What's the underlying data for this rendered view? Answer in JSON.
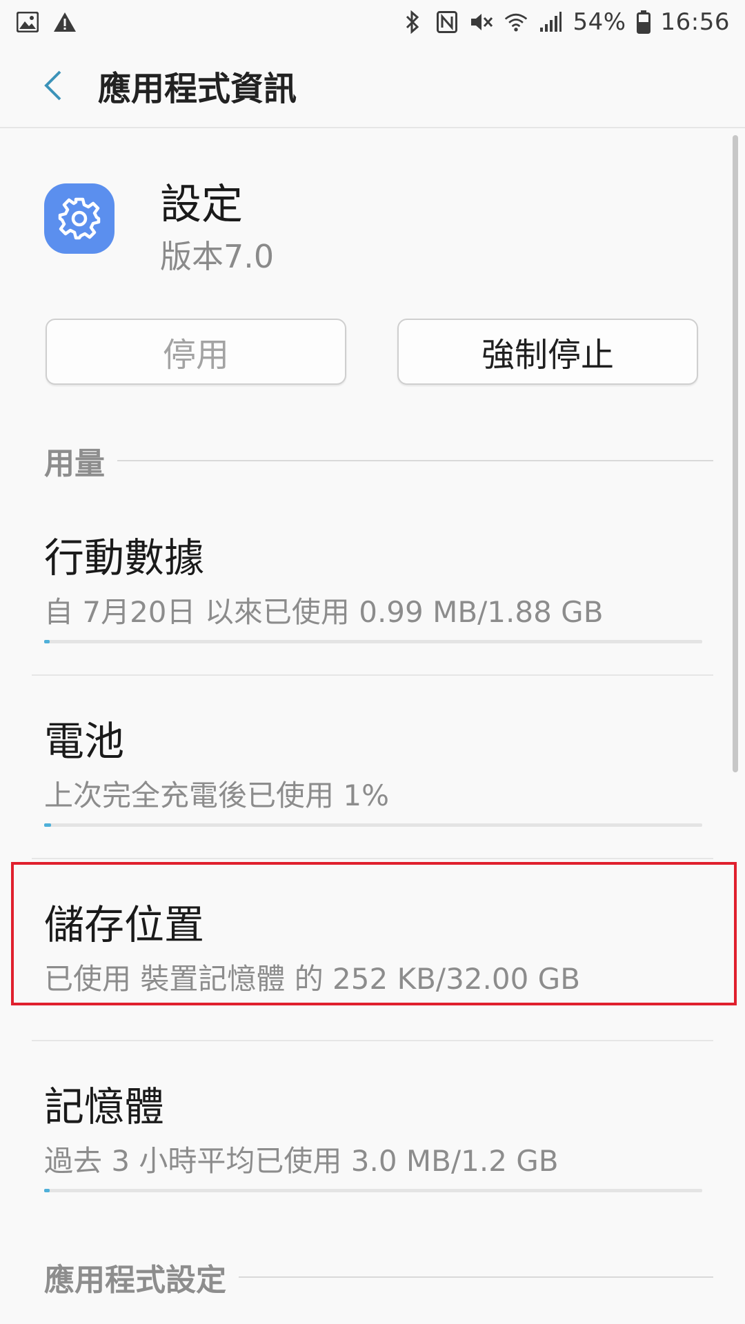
{
  "status_bar": {
    "battery_percent": "54%",
    "time": "16:56",
    "left_icons": [
      "image-icon",
      "warning-icon"
    ],
    "right_icons": [
      "bluetooth-icon",
      "nfc-icon",
      "mute-icon",
      "wifi-icon",
      "signal-icon",
      "battery-icon"
    ]
  },
  "app_bar": {
    "title": "應用程式資訊"
  },
  "app": {
    "name": "設定",
    "version": "版本7.0",
    "icon": "gear-icon",
    "icon_color": "#5b8fee"
  },
  "buttons": {
    "disable": "停用",
    "force_stop": "強制停止"
  },
  "sections": {
    "usage": "用量",
    "app_settings": "應用程式設定"
  },
  "items": [
    {
      "title": "行動數據",
      "subtitle": "自 7月20日 以來已使用 0.99 MB/1.88 GB",
      "progress": 0.0005
    },
    {
      "title": "電池",
      "subtitle": "上次完全充電後已使用 1%",
      "progress": 0.01
    },
    {
      "title": "儲存位置",
      "subtitle": "已使用 裝置記憶體 的 252 KB/32.00 GB"
    },
    {
      "title": "記憶體",
      "subtitle": "過去 3 小時平均已使用 3.0 MB/1.2 GB",
      "progress": 0.0025
    }
  ],
  "colors": {
    "accent": "#4fb0d9",
    "highlight": "#e0202e",
    "background": "#f9f9f9"
  }
}
